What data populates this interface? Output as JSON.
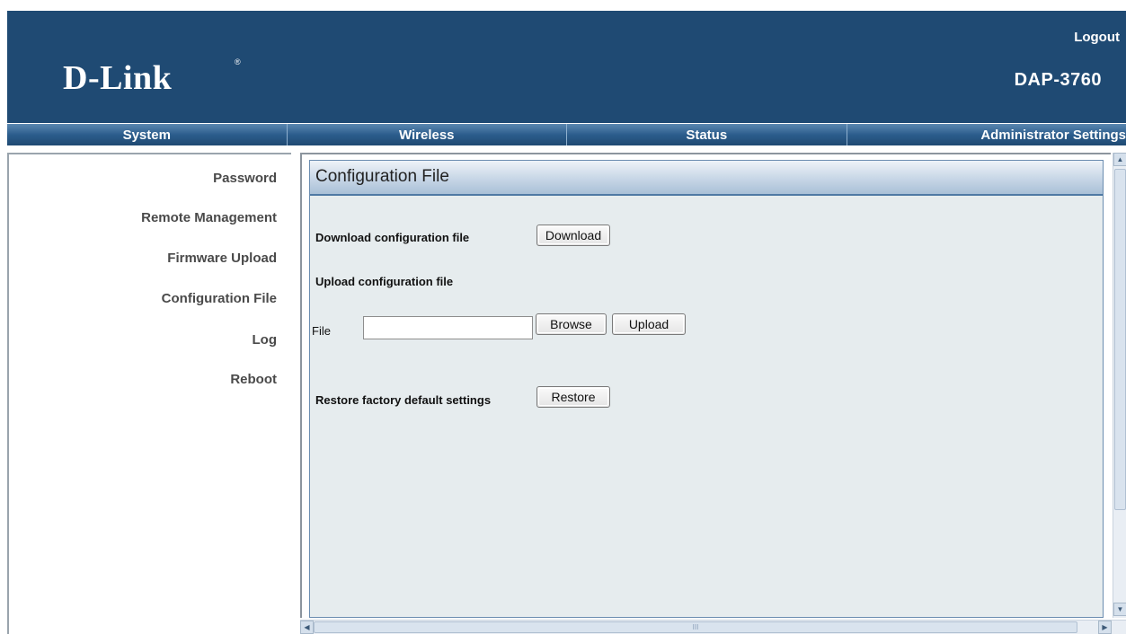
{
  "header": {
    "brand": "D-Link",
    "brand_mark": "®",
    "logout_label": "Logout",
    "model": "DAP-3760"
  },
  "nav": {
    "tabs": [
      {
        "label": "System"
      },
      {
        "label": "Wireless"
      },
      {
        "label": "Status"
      },
      {
        "label": "Administrator Settings"
      }
    ]
  },
  "sidebar": {
    "items": [
      {
        "label": "Password"
      },
      {
        "label": "Remote Management"
      },
      {
        "label": "Firmware Upload"
      },
      {
        "label": "Configuration File"
      },
      {
        "label": "Log"
      },
      {
        "label": "Reboot"
      }
    ]
  },
  "main": {
    "title": "Configuration File",
    "download_label": "Download configuration file",
    "download_button": "Download",
    "upload_label": "Upload configuration file",
    "file_label": "File",
    "file_value": "",
    "browse_button": "Browse",
    "upload_button": "Upload",
    "restore_label": "Restore factory default settings",
    "restore_button": "Restore"
  },
  "scroll": {
    "up": "▲",
    "down": "▼",
    "left": "◀",
    "right": "▶",
    "grip": "III"
  }
}
